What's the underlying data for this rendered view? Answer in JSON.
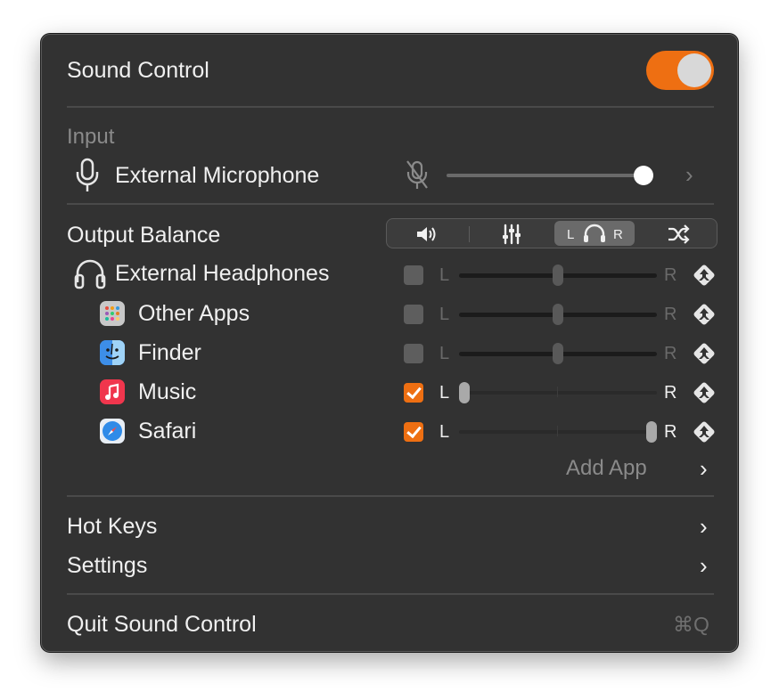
{
  "header": {
    "title": "Sound Control",
    "enabled": true
  },
  "input": {
    "section_label": "Input",
    "device_name": "External Microphone",
    "volume": 1.0
  },
  "output": {
    "section_label": "Output Balance",
    "modes": [
      "volume-icon",
      "equalizer-icon",
      "balance-icon",
      "shuffle-icon"
    ],
    "selected_mode": "balance-icon",
    "balance_mode_label_left": "L",
    "balance_mode_label_right": "R",
    "device_name": "External Headphones",
    "device_checked": false,
    "device_balance": 0.5,
    "left_label": "L",
    "right_label": "R",
    "apps": [
      {
        "name": "Other Apps",
        "checked": false,
        "balance": 0.5
      },
      {
        "name": "Finder",
        "checked": false,
        "balance": 0.5
      },
      {
        "name": "Music",
        "checked": true,
        "balance": 0.0
      },
      {
        "name": "Safari",
        "checked": true,
        "balance": 1.0
      }
    ],
    "add_app_label": "Add App"
  },
  "menu": {
    "hot_keys_label": "Hot Keys",
    "settings_label": "Settings",
    "quit_label": "Quit Sound Control",
    "quit_shortcut": "⌘Q"
  },
  "colors": {
    "accent": "#EE6F12",
    "panel_bg": "#323232"
  }
}
